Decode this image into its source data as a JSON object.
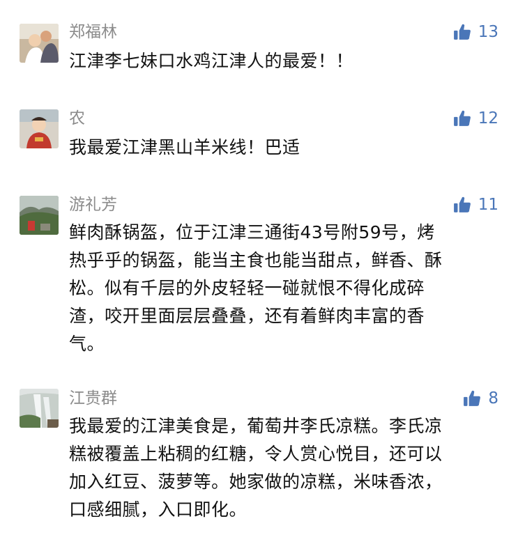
{
  "comments": [
    {
      "author": "郑福林",
      "likes": "13",
      "lines": [
        "江津李七妹口水鸡江津人的最爱！！"
      ]
    },
    {
      "author": "农",
      "likes": "12",
      "lines": [
        "我最爱江津黑山羊米线！巴适"
      ]
    },
    {
      "author": "游礼芳",
      "likes": "11",
      "lines": [
        "鲜肉酥锅盔，位于江津三通街43号附59号，烤",
        "热乎乎的锅盔，能当主食也能当甜点，鲜香、酥",
        "松。似有千层的外皮轻轻一碰就恨不得化成碎",
        "渣，咬开里面层层叠叠，还有着鲜肉丰富的香",
        "气。"
      ]
    },
    {
      "author": "江贵群",
      "likes": "8",
      "lines": [
        "我最爱的江津美食是，葡萄井李氏凉糕。李氏凉",
        "糕被覆盖上粘稠的红糖，令人赏心悦目，还可以",
        "加入红豆、菠萝等。她家做的凉糕，米味香浓，",
        "口感细腻，入口即化。"
      ]
    }
  ],
  "colors": {
    "like_blue": "#4a76b8",
    "name_gray": "#8b8b8b",
    "text": "#111111"
  },
  "icons": {
    "like": "thumbs-up-icon"
  }
}
